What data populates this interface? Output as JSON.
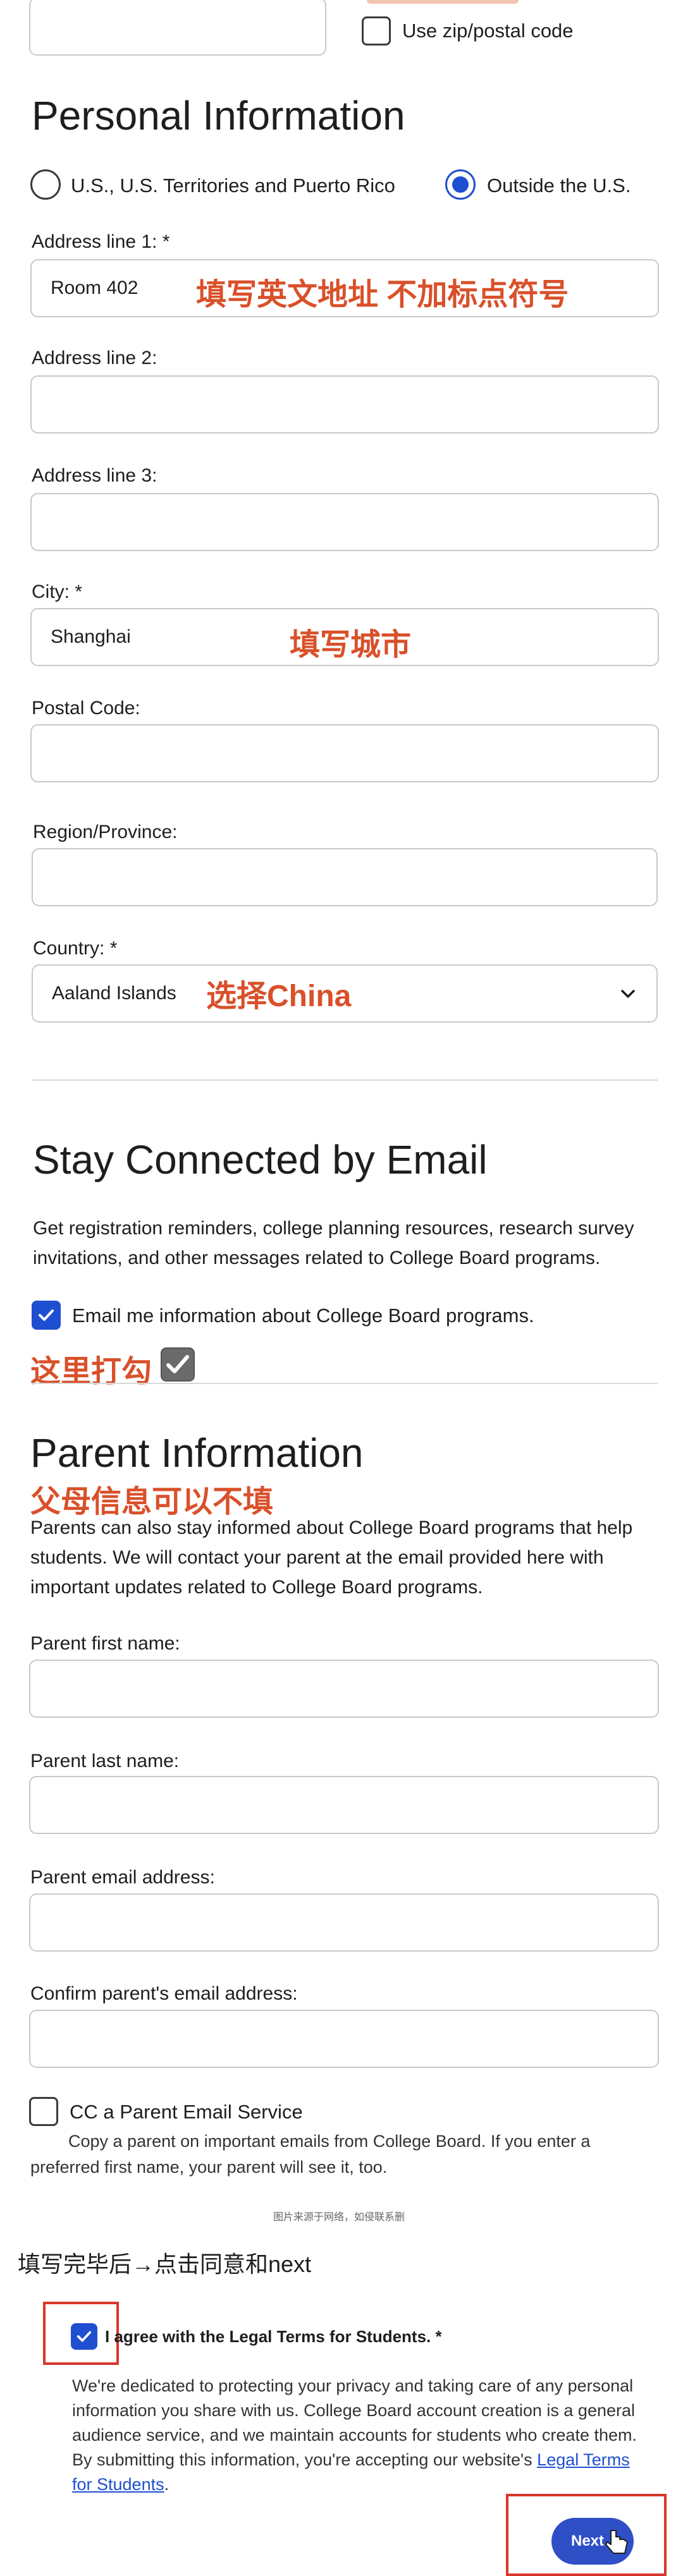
{
  "top": {
    "zip_checkbox_label": "Use zip/postal code"
  },
  "personal": {
    "title": "Personal Information",
    "radio_us_label": "U.S., U.S. Territories and Puerto Rico",
    "radio_outside_label": "Outside the U.S.",
    "address1_label": "Address line 1: *",
    "address1_value": "Room 402",
    "address1_note": "填写英文地址 不加标点符号",
    "address2_label": "Address line 2:",
    "address3_label": "Address line 3:",
    "city_label": "City: *",
    "city_value": "Shanghai",
    "city_note": "填写城市",
    "postal_label": "Postal Code:",
    "region_label": "Region/Province:",
    "country_label": "Country: *",
    "country_value": "Aaland Islands",
    "country_note": "选择China"
  },
  "email_section": {
    "title": "Stay Connected by Email",
    "description_line1": "Get registration reminders, college planning resources, research survey",
    "description_line2": "invitations, and other messages related to College Board programs.",
    "checkbox_label": "Email me information about College Board programs.",
    "checkbox_note": "这里打勾"
  },
  "parent": {
    "title": "Parent Information",
    "note": "父母信息可以不填",
    "description_line1": "Parents can also stay informed about College Board programs that help",
    "description_line2": "students. We will contact your parent at the email provided here with",
    "description_line3": "important updates related to College Board programs.",
    "first_name_label": "Parent first name:",
    "last_name_label": "Parent last name:",
    "email_label": "Parent email address:",
    "confirm_email_label": "Confirm parent's email address:",
    "cc_label": "CC a Parent Email Service",
    "cc_desc_line1": "Copy a parent on important emails from College Board. If you enter a",
    "cc_desc_line2": "preferred first name, your parent will see it, too."
  },
  "footer": {
    "watermark": "图片来源于网络，如侵联系删",
    "instruction": "填写完毕后→点击同意和next",
    "agree_label": "I agree with the Legal Terms for Students. *",
    "legal_line1": "We're dedicated to protecting your privacy and taking care of any personal",
    "legal_line2": "information you share with us. College Board account creation is a general",
    "legal_line3": "audience service, and we maintain accounts for students who create them.",
    "legal_line4": "By submitting this information, you're accepting our website's",
    "legal_link_line1": "Legal Terms",
    "legal_link_line2": "for Students",
    "legal_end": ".",
    "next_label": "Next"
  },
  "colors": {
    "accent": "#1f4fd1",
    "annotation": "#d9502a",
    "highlight_box": "#d9362b"
  }
}
